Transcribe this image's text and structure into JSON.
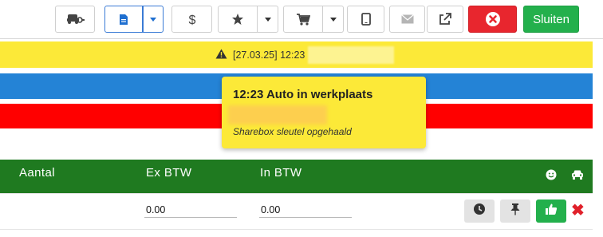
{
  "toolbar": {
    "close_label": "Sluiten",
    "icons": [
      "car-key-icon",
      "document-icon",
      "dollar-icon",
      "star-icon",
      "cart-icon",
      "tablet-icon",
      "mail-icon",
      "external-link-icon",
      "close-circle-icon"
    ]
  },
  "alert_bar": {
    "text": "[27.03.25] 12:23"
  },
  "popover": {
    "title": "12:23 Auto in werkplaats",
    "note": "Sharebox sleutel opgehaald"
  },
  "table": {
    "headers": [
      "Aantal",
      "Ex BTW",
      "In BTW"
    ],
    "row": {
      "ex_btw": "0.00",
      "in_btw": "0.00"
    }
  },
  "colors": {
    "yellow": "#fce938",
    "blue": "#2483d6",
    "red": "#ff0000",
    "green_header": "#1f7a20",
    "button_green": "#23b04c",
    "button_red": "#e8262e"
  }
}
